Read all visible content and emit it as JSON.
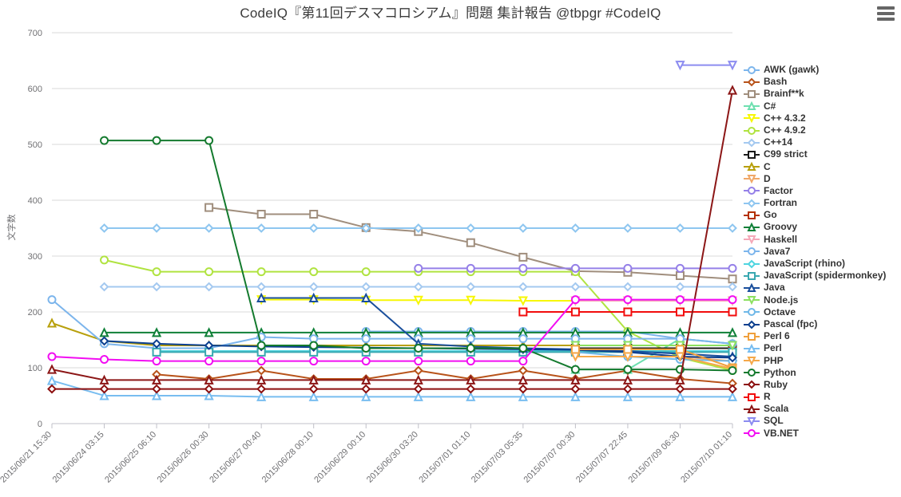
{
  "title": "CodeIQ『第11回デスマコロシアム』問題 集計報告 @tbpgr #CodeIQ",
  "menu": {
    "name": "hamburger-menu",
    "label": "Chart context menu"
  },
  "chart_data": {
    "type": "line",
    "title": "CodeIQ『第11回デスマコロシアム』問題 集計報告 @tbpgr #CodeIQ",
    "xlabel": "",
    "ylabel": "文字数",
    "ylim": [
      0,
      700
    ],
    "yticks": [
      0,
      100,
      200,
      300,
      400,
      500,
      600,
      700
    ],
    "grid": true,
    "legend_position": "right",
    "categories": [
      "2015/06/21 15:30",
      "2015/06/24 03:15",
      "2015/06/25 06:10",
      "2015/06/26 00:30",
      "2015/06/27 00:40",
      "2015/06/28 00:10",
      "2015/06/29 00:10",
      "2015/06/30 03:20",
      "2015/07/01 01:10",
      "2015/07/03 05:35",
      "2015/07/07 00:30",
      "2015/07/07 22:45",
      "2015/07/09 06:30",
      "2015/07/10 01:10"
    ],
    "series": [
      {
        "name": "AWK (gawk)",
        "color": "#7cb5ec",
        "marker": "circle",
        "values": [
          null,
          null,
          null,
          null,
          null,
          null,
          165,
          165,
          165,
          165,
          165,
          165,
          152,
          143
        ]
      },
      {
        "name": "Bash",
        "color": "#b8531a",
        "marker": "diamond",
        "values": [
          null,
          null,
          88,
          80,
          95,
          80,
          80,
          95,
          80,
          95,
          80,
          95,
          80,
          72
        ]
      },
      {
        "name": "Brainf**k",
        "color": "#a08e7d",
        "marker": "square",
        "values": [
          null,
          null,
          null,
          387,
          375,
          375,
          351,
          344,
          324,
          298,
          273,
          271,
          265,
          259
        ]
      },
      {
        "name": "C#",
        "color": "#6ee0b0",
        "marker": "triangle",
        "values": [
          null,
          null,
          null,
          null,
          null,
          null,
          null,
          null,
          null,
          null,
          97,
          97,
          152,
          143
        ]
      },
      {
        "name": "C++ 4.3.2",
        "color": "#f7f704",
        "marker": "triangle-down",
        "values": [
          null,
          null,
          null,
          null,
          222,
          222,
          221,
          221,
          221,
          220,
          220,
          220,
          220,
          220
        ]
      },
      {
        "name": "C++ 4.9.2",
        "color": "#b0e340",
        "marker": "circle",
        "values": [
          null,
          293,
          272,
          272,
          272,
          272,
          272,
          272,
          272,
          272,
          272,
          165,
          118,
          95
        ]
      },
      {
        "name": "C++14",
        "color": "#a4c9f0",
        "marker": "diamond",
        "values": [
          null,
          245,
          245,
          245,
          245,
          245,
          245,
          245,
          245,
          245,
          245,
          245,
          245,
          245
        ]
      },
      {
        "name": "C99 strict",
        "color": "#1a1a1a",
        "marker": "square",
        "values": [
          null,
          null,
          null,
          null,
          null,
          null,
          null,
          null,
          null,
          null,
          135,
          135,
          135,
          135
        ]
      },
      {
        "name": "C",
        "color": "#b8a00c",
        "marker": "triangle",
        "values": [
          180,
          148,
          140,
          140,
          140,
          140,
          140,
          140,
          140,
          140,
          140,
          140,
          140,
          140
        ]
      },
      {
        "name": "D",
        "color": "#f0a868",
        "marker": "triangle-down",
        "values": [
          null,
          null,
          null,
          null,
          null,
          null,
          null,
          null,
          null,
          null,
          null,
          120,
          120,
          112
        ]
      },
      {
        "name": "Factor",
        "color": "#9580e8",
        "marker": "circle",
        "values": [
          null,
          null,
          null,
          null,
          null,
          null,
          null,
          278,
          278,
          278,
          278,
          278,
          278,
          278
        ]
      },
      {
        "name": "Fortran",
        "color": "#8ec6f0",
        "marker": "diamond",
        "values": [
          null,
          350,
          350,
          350,
          350,
          350,
          350,
          350,
          350,
          350,
          350,
          350,
          350,
          350
        ]
      },
      {
        "name": "Go",
        "color": "#b33000",
        "marker": "square",
        "values": [
          null,
          null,
          null,
          null,
          null,
          null,
          null,
          null,
          null,
          null,
          130,
          130,
          130,
          130
        ]
      },
      {
        "name": "Groovy",
        "color": "#108038",
        "marker": "triangle",
        "values": [
          null,
          163,
          163,
          163,
          163,
          163,
          163,
          163,
          163,
          163,
          163,
          163,
          163,
          163
        ]
      },
      {
        "name": "Haskell",
        "color": "#f5a8b8",
        "marker": "triangle-down",
        "values": [
          null,
          null,
          null,
          null,
          null,
          null,
          null,
          null,
          null,
          null,
          220,
          220,
          220,
          220
        ]
      },
      {
        "name": "Java7",
        "color": "#7cb5ec",
        "marker": "circle",
        "values": [
          222,
          143,
          135,
          135,
          155,
          152,
          152,
          152,
          152,
          152,
          152,
          152,
          152,
          143
        ]
      },
      {
        "name": "JavaScript (rhino)",
        "color": "#4fd5e0",
        "marker": "diamond",
        "values": [
          null,
          null,
          130,
          130,
          130,
          130,
          130,
          130,
          130,
          130,
          130,
          130,
          130,
          130
        ]
      },
      {
        "name": "JavaScript (spidermonkey)",
        "color": "#3aa8b0",
        "marker": "square",
        "values": [
          null,
          null,
          128,
          128,
          128,
          128,
          128,
          128,
          128,
          128,
          128,
          128,
          128,
          128
        ]
      },
      {
        "name": "Java",
        "color": "#1a4f9c",
        "marker": "triangle",
        "values": [
          null,
          null,
          null,
          null,
          225,
          225,
          225,
          143,
          138,
          135,
          133,
          130,
          125,
          120
        ]
      },
      {
        "name": "Node.js",
        "color": "#8ce060",
        "marker": "triangle-down",
        "values": [
          null,
          null,
          null,
          null,
          null,
          null,
          null,
          null,
          null,
          null,
          140,
          140,
          140,
          140
        ]
      },
      {
        "name": "Octave",
        "color": "#6fb8e8",
        "marker": "circle",
        "values": [
          null,
          null,
          null,
          null,
          null,
          null,
          null,
          null,
          null,
          null,
          128,
          120,
          115,
          112
        ]
      },
      {
        "name": "Pascal (fpc)",
        "color": "#0b3f8f",
        "marker": "diamond",
        "values": [
          null,
          148,
          143,
          140,
          138,
          137,
          136,
          135,
          134,
          133,
          132,
          128,
          120,
          118
        ]
      },
      {
        "name": "Perl 6",
        "color": "#f0a03c",
        "marker": "square",
        "values": [
          null,
          null,
          null,
          null,
          null,
          null,
          null,
          null,
          null,
          null,
          133,
          133,
          133,
          100
        ]
      },
      {
        "name": "Perl",
        "color": "#78bdf0",
        "marker": "triangle",
        "values": [
          77,
          50,
          50,
          50,
          48,
          48,
          48,
          48,
          48,
          48,
          48,
          48,
          48,
          48
        ]
      },
      {
        "name": "PHP",
        "color": "#f5a84a",
        "marker": "triangle-down",
        "values": [
          null,
          null,
          null,
          null,
          null,
          null,
          null,
          null,
          null,
          null,
          120,
          120,
          120,
          98
        ]
      },
      {
        "name": "Python",
        "color": "#147a2e",
        "marker": "circle",
        "values": [
          null,
          507,
          507,
          507,
          140,
          140,
          135,
          135,
          135,
          135,
          97,
          97,
          97,
          95
        ]
      },
      {
        "name": "Ruby",
        "color": "#8c0e0e",
        "marker": "diamond",
        "values": [
          62,
          62,
          62,
          62,
          62,
          62,
          62,
          62,
          62,
          62,
          62,
          62,
          62,
          62
        ]
      },
      {
        "name": "R",
        "color": "#f20d0d",
        "marker": "square",
        "values": [
          null,
          null,
          null,
          null,
          null,
          null,
          null,
          null,
          null,
          200,
          200,
          200,
          200,
          200
        ]
      },
      {
        "name": "Scala",
        "color": "#8c1616",
        "marker": "triangle",
        "values": [
          97,
          78,
          78,
          78,
          78,
          78,
          78,
          78,
          78,
          78,
          78,
          78,
          78,
          597
        ]
      },
      {
        "name": "SQL",
        "color": "#8c8cf0",
        "marker": "triangle-down",
        "values": [
          null,
          null,
          null,
          null,
          null,
          null,
          null,
          null,
          null,
          null,
          null,
          null,
          642,
          642
        ]
      },
      {
        "name": "VB.NET",
        "color": "#f20df2",
        "marker": "circle",
        "values": [
          120,
          115,
          112,
          112,
          112,
          112,
          112,
          112,
          112,
          112,
          222,
          222,
          222,
          222
        ]
      }
    ]
  },
  "legend": {
    "items": [
      {
        "label": "AWK (gawk)",
        "color": "#7cb5ec",
        "marker": "circle"
      },
      {
        "label": "Bash",
        "color": "#b8531a",
        "marker": "diamond"
      },
      {
        "label": "Brainf**k",
        "color": "#a08e7d",
        "marker": "square"
      },
      {
        "label": "C#",
        "color": "#6ee0b0",
        "marker": "triangle"
      },
      {
        "label": "C++ 4.3.2",
        "color": "#f7f704",
        "marker": "triangle-down"
      },
      {
        "label": "C++ 4.9.2",
        "color": "#b0e340",
        "marker": "circle"
      },
      {
        "label": "C++14",
        "color": "#a4c9f0",
        "marker": "diamond"
      },
      {
        "label": "C99 strict",
        "color": "#1a1a1a",
        "marker": "square"
      },
      {
        "label": "C",
        "color": "#b8a00c",
        "marker": "triangle"
      },
      {
        "label": "D",
        "color": "#f0a868",
        "marker": "triangle-down"
      },
      {
        "label": "Factor",
        "color": "#9580e8",
        "marker": "circle"
      },
      {
        "label": "Fortran",
        "color": "#8ec6f0",
        "marker": "diamond"
      },
      {
        "label": "Go",
        "color": "#b33000",
        "marker": "square"
      },
      {
        "label": "Groovy",
        "color": "#108038",
        "marker": "triangle"
      },
      {
        "label": "Haskell",
        "color": "#f5a8b8",
        "marker": "triangle-down"
      },
      {
        "label": "Java7",
        "color": "#7cb5ec",
        "marker": "circle"
      },
      {
        "label": "JavaScript (rhino)",
        "color": "#4fd5e0",
        "marker": "diamond"
      },
      {
        "label": "JavaScript (spidermonkey)",
        "color": "#3aa8b0",
        "marker": "square"
      },
      {
        "label": "Java",
        "color": "#1a4f9c",
        "marker": "triangle"
      },
      {
        "label": "Node.js",
        "color": "#8ce060",
        "marker": "triangle-down"
      },
      {
        "label": "Octave",
        "color": "#6fb8e8",
        "marker": "circle"
      },
      {
        "label": "Pascal (fpc)",
        "color": "#0b3f8f",
        "marker": "diamond"
      },
      {
        "label": "Perl 6",
        "color": "#f0a03c",
        "marker": "square"
      },
      {
        "label": "Perl",
        "color": "#78bdf0",
        "marker": "triangle"
      },
      {
        "label": "PHP",
        "color": "#f5a84a",
        "marker": "triangle-down"
      },
      {
        "label": "Python",
        "color": "#147a2e",
        "marker": "circle"
      },
      {
        "label": "Ruby",
        "color": "#8c0e0e",
        "marker": "diamond"
      },
      {
        "label": "R",
        "color": "#f20d0d",
        "marker": "square"
      },
      {
        "label": "Scala",
        "color": "#8c1616",
        "marker": "triangle"
      },
      {
        "label": "SQL",
        "color": "#8c8cf0",
        "marker": "triangle-down"
      },
      {
        "label": "VB.NET",
        "color": "#f20df2",
        "marker": "circle"
      }
    ]
  }
}
